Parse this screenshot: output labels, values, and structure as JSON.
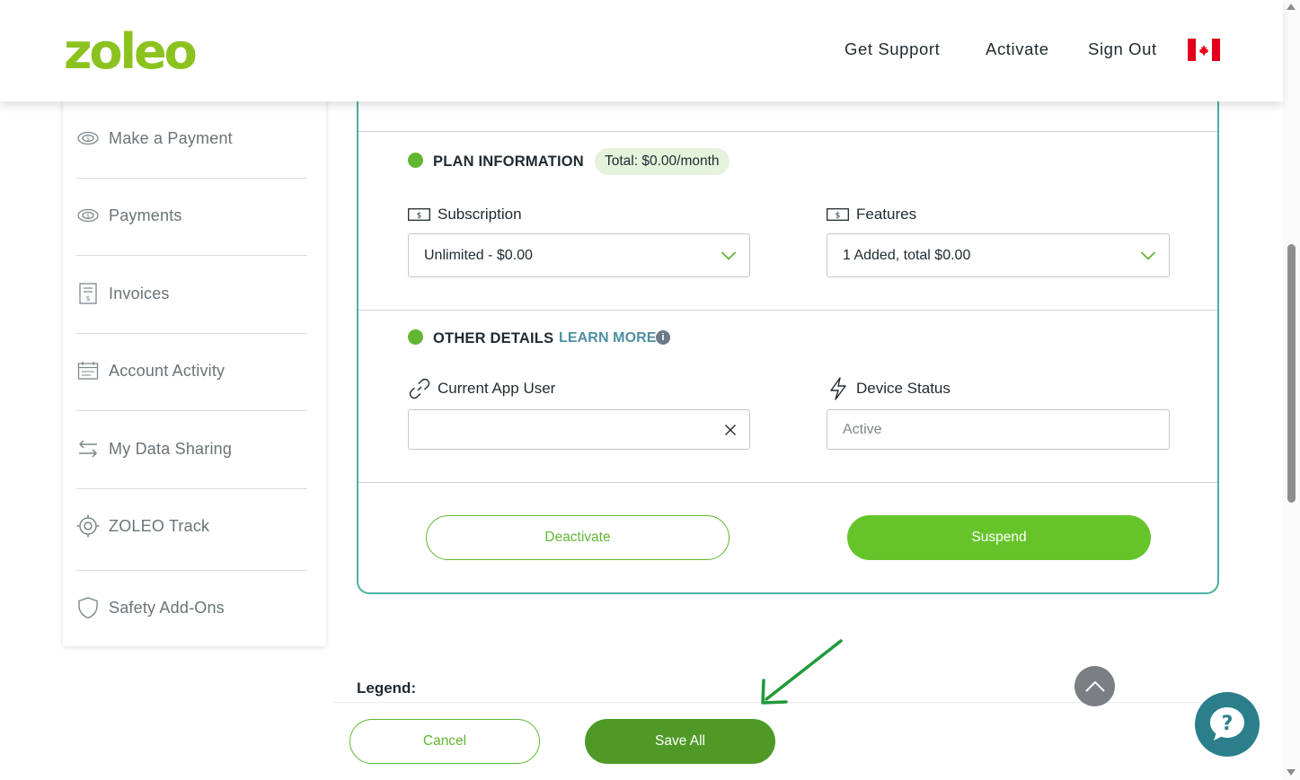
{
  "header": {
    "logo_text": "zoleo",
    "nav": [
      "Get Support",
      "Activate",
      "Sign Out"
    ],
    "flag": "canada-flag"
  },
  "sidebar": {
    "items": [
      {
        "label": "Make a Payment",
        "icon": "money-icon"
      },
      {
        "label": "Payments",
        "icon": "money-icon"
      },
      {
        "label": "Invoices",
        "icon": "invoice-icon"
      },
      {
        "label": "Account Activity",
        "icon": "calendar-icon"
      },
      {
        "label": "My Data Sharing",
        "icon": "swap-arrows-icon"
      },
      {
        "label": "ZOLEO Track",
        "icon": "target-icon"
      },
      {
        "label": "Safety Add-Ons",
        "icon": "shield-icon"
      }
    ]
  },
  "plan": {
    "title": "PLAN INFORMATION",
    "total_pill": "Total: $0.00/month",
    "subscription_label": "Subscription",
    "subscription_value": "Unlimited - $0.00",
    "features_label": "Features",
    "features_value": "1 Added, total $0.00"
  },
  "other": {
    "title": "OTHER DETAILS",
    "learn_more": "LEARN MORE",
    "app_user_label": "Current App User",
    "app_user_value": "",
    "device_status_label": "Device Status",
    "device_status_value": "Active"
  },
  "actions": {
    "deactivate": "Deactivate",
    "suspend": "Suspend"
  },
  "bottom": {
    "legend": "Legend:",
    "cancel": "Cancel",
    "save_all": "Save All"
  },
  "colors": {
    "brand_green": "#66c42a",
    "dark_green": "#4f9a26",
    "teal_border": "#4aaea3",
    "help_teal": "#2a7f8b",
    "annotation_arrow": "#1f9a3a"
  }
}
